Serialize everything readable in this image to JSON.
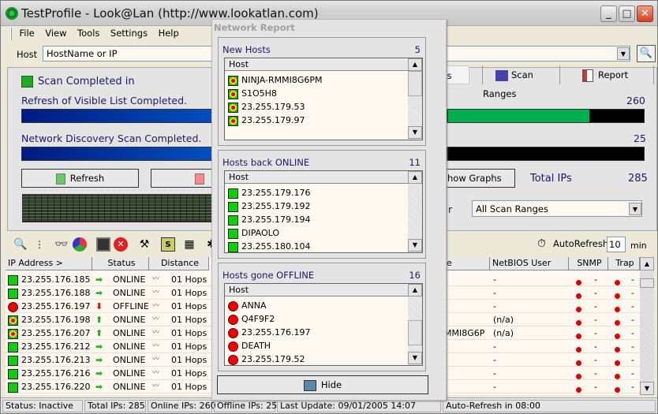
{
  "window": {
    "title": "TestProfile - Look@Lan (http://www.lookatlan.com)",
    "min_symbol": "_",
    "max_symbol": "□",
    "close_symbol": "✕"
  },
  "menu": [
    "File",
    "View",
    "Tools",
    "Settings",
    "Help"
  ],
  "hostbar": {
    "label": "Host",
    "value": "HostName or IP",
    "dropdown_arrow": "▼",
    "search_icon": "🔍"
  },
  "scan_panel": {
    "scan_status": "Scan Completed in",
    "refresh_label": "Refresh of Visible List Completed.",
    "refresh_count": "260",
    "refresh_progress_pct": 100,
    "online_fill_pct": 91,
    "discovery_label": "Network Discovery Scan Completed.",
    "discovery_count": "25",
    "discovery_progress_pct": 100,
    "offline_fill_pct": 0,
    "refresh_button": "Refresh",
    "show_graphs_button": "Show Graphs",
    "show_graphs_visible": "how Graphs",
    "total_ips_label": "Total IPs",
    "total_ips_value": "285",
    "filter_label_partial": "r",
    "filter_select": "All Scan Ranges"
  },
  "tabs": [
    {
      "label": "ts",
      "active": true
    },
    {
      "label": "Scan Ranges",
      "icon": "network-icon"
    },
    {
      "label": "Report",
      "icon": "report-icon"
    }
  ],
  "toolbar": {
    "autorefresh_label": "AutoRefresh",
    "autorefresh_value": "10",
    "autorefresh_unit": "min"
  },
  "grid": {
    "columns": [
      "IP Address >",
      "Status",
      "Distance",
      "e",
      "NetBIOS User",
      "SNMP",
      "Trap"
    ],
    "rows": [
      {
        "icon": "online",
        "ip": "23.255.176.185",
        "arrow": "right",
        "status": "ONLINE",
        "distance": "01 Hops",
        "name": "",
        "netbios_user": "-",
        "snmp": "-",
        "trap": "-"
      },
      {
        "icon": "online",
        "ip": "23.255.176.188",
        "arrow": "right",
        "status": "ONLINE",
        "distance": "01 Hops",
        "name": "",
        "netbios_user": "-",
        "snmp": "-",
        "trap": "-"
      },
      {
        "icon": "offline",
        "ip": "23.255.176.197",
        "arrow": "down",
        "status": "OFFLINE",
        "distance": "01 Hops",
        "name": "",
        "netbios_user": "-",
        "snmp": "-",
        "trap": "-"
      },
      {
        "icon": "new",
        "ip": "23.255.176.198",
        "arrow": "up",
        "status": "ONLINE",
        "distance": "01 Hops",
        "name": "",
        "netbios_user": "(n/a)",
        "snmp": "-",
        "trap": "-"
      },
      {
        "icon": "new",
        "ip": "23.255.176.207",
        "arrow": "up",
        "status": "ONLINE",
        "distance": "01 Hops",
        "name": "MMI8G6P",
        "netbios_user": "(n/a)",
        "snmp": "-",
        "trap": "-"
      },
      {
        "icon": "online",
        "ip": "23.255.176.212",
        "arrow": "right",
        "status": "ONLINE",
        "distance": "01 Hops",
        "name": "",
        "netbios_user": "-",
        "snmp": "-",
        "trap": "-"
      },
      {
        "icon": "online",
        "ip": "23.255.176.213",
        "arrow": "right",
        "status": "ONLINE",
        "distance": "01 Hops",
        "name": "",
        "netbios_user": "-",
        "snmp": "-",
        "trap": "-"
      },
      {
        "icon": "online",
        "ip": "23.255.176.216",
        "arrow": "right",
        "status": "ONLINE",
        "distance": "01 Hops",
        "name": "",
        "netbios_user": "-",
        "snmp": "-",
        "trap": "-"
      },
      {
        "icon": "online",
        "ip": "23.255.176.220",
        "arrow": "right",
        "status": "ONLINE",
        "distance": "01 Hops",
        "name": "",
        "netbios_user": "-",
        "snmp": "-",
        "trap": "-"
      }
    ]
  },
  "statusbar": {
    "status": "Status: Inactive",
    "total": "Total IPs: 285",
    "online": "Online IPs: 260",
    "offline": "Offline IPs: 25",
    "last_update": "Last Update: 09/01/2005 14:07",
    "auto_refresh": "Auto-Refresh in 08:00"
  },
  "report": {
    "title": "Network Report",
    "column_header": "Host",
    "hide_button": "Hide",
    "groups": [
      {
        "label": "New Hosts",
        "count": "5",
        "icon": "new",
        "items": [
          "NINJA-RMMI8G6PM",
          "S1O5H8",
          "23.255.179.53",
          "23.255.179.97"
        ]
      },
      {
        "label": "Hosts back ONLINE",
        "count": "11",
        "icon": "online",
        "items": [
          "23.255.179.176",
          "23.255.179.192",
          "23.255.179.194",
          "DIPAOLO",
          "23.255.180.104"
        ]
      },
      {
        "label": "Hosts gone OFFLINE",
        "count": "16",
        "icon": "offline",
        "items": [
          "ANNA",
          "Q4F9F2",
          "23.255.176.197",
          "DEATH",
          "23.255.179.52"
        ]
      }
    ]
  },
  "colors": {
    "label_blue": "#1a1a6a",
    "online_green": "#11cc11",
    "offline_red": "#ee0000",
    "progress_blue": "#0040b0",
    "online_bar_green": "#00b050"
  }
}
